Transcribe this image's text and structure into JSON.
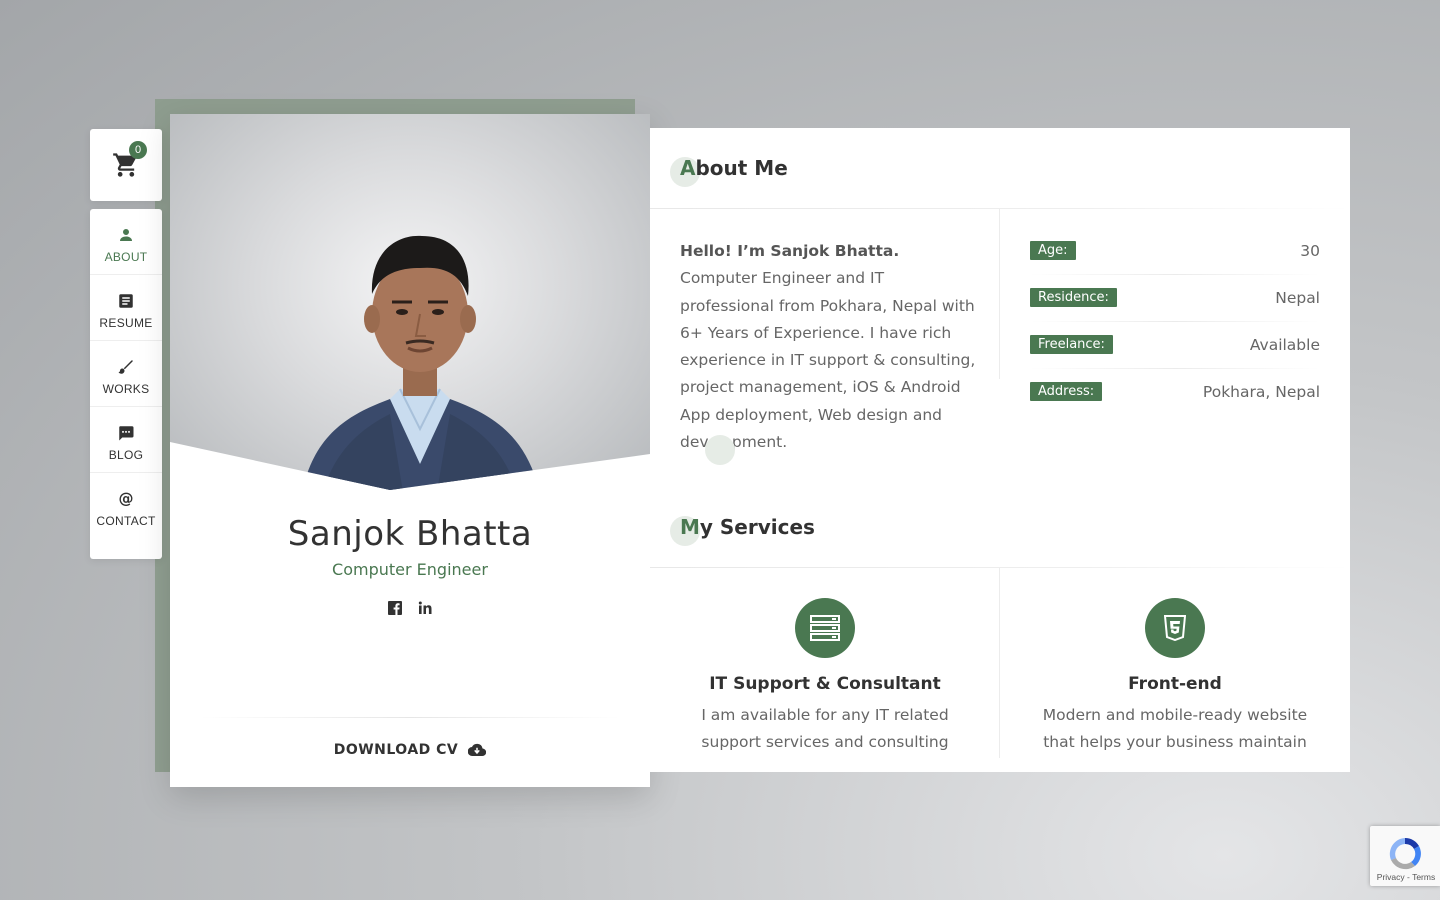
{
  "cart": {
    "count": "0",
    "icon": "cart-icon"
  },
  "nav": {
    "items": [
      {
        "label": "ABOUT",
        "icon": "person-icon",
        "active": true
      },
      {
        "label": "RESUME",
        "icon": "document-icon",
        "active": false
      },
      {
        "label": "WORKS",
        "icon": "brush-icon",
        "active": false
      },
      {
        "label": "BLOG",
        "icon": "chat-icon",
        "active": false
      },
      {
        "label": "CONTACT",
        "icon": "at-icon",
        "active": false
      }
    ]
  },
  "profile": {
    "name": "Sanjok Bhatta",
    "subtitle": "Computer Engineer",
    "socials": [
      "facebook-icon",
      "linkedin-icon"
    ],
    "download_label": "DOWNLOAD CV"
  },
  "about": {
    "title_first": "A",
    "title_rest": "bout Me",
    "hello": "Hello! I’m Sanjok Bhatta.",
    "body": "Computer Engineer and IT professional from Pokhara, Nepal with 6+ Years of Experience. I have rich experience in IT support & consulting, project management, iOS & Android App deployment, Web design and development.",
    "info": [
      {
        "label": "Age:",
        "value": "30"
      },
      {
        "label": "Residence:",
        "value": "Nepal"
      },
      {
        "label": "Freelance:",
        "value": "Available"
      },
      {
        "label": "Address:",
        "value": "Pokhara, Nepal"
      }
    ]
  },
  "services": {
    "title_first": "M",
    "title_rest": "y Services",
    "items": [
      {
        "title": "IT Support & Consultant",
        "desc": "I am available for any IT related support services and consulting",
        "icon": "server-icon"
      },
      {
        "title": "Front-end",
        "desc": "Modern and mobile-ready website that helps your business maintain",
        "icon": "html5-icon"
      }
    ]
  },
  "recaptcha": {
    "privacy": "Privacy",
    "terms": "Terms"
  },
  "colors": {
    "accent": "#4a7851",
    "text": "#323232",
    "muted": "#666666"
  }
}
